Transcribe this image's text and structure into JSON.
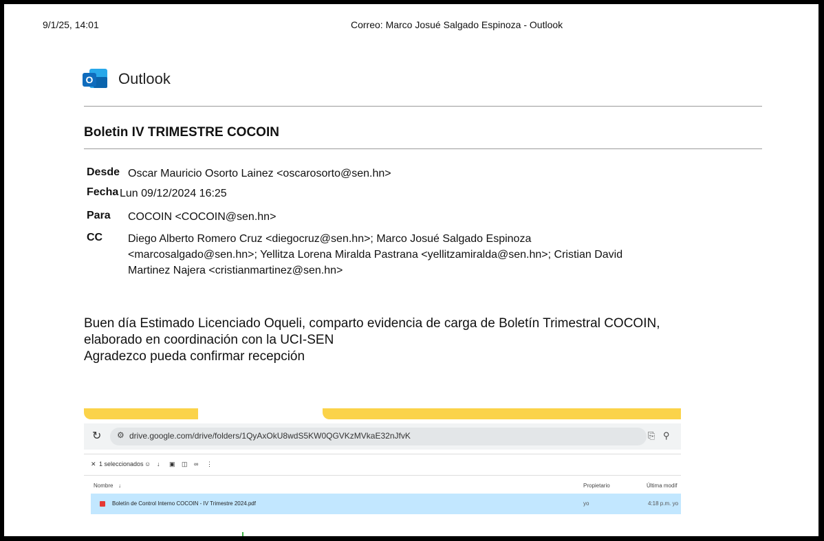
{
  "print_header": {
    "date": "9/1/25, 14:01",
    "title": "Correo: Marco Josué Salgado Espinoza - Outlook"
  },
  "brand": {
    "logo_letter": "O",
    "name": "Outlook"
  },
  "email": {
    "subject": "Boletin IV TRIMESTRE COCOIN",
    "from_label": "Desde",
    "from": "Oscar Mauricio Osorto Lainez <oscarosorto@sen.hn>",
    "date_label": "Fecha",
    "date": "Lun 09/12/2024 16:25",
    "to_label": "Para",
    "to": "COCOIN <COCOIN@sen.hn>",
    "cc_label": "CC",
    "cc_lines": [
      "Diego Alberto Romero Cruz <diegocruz@sen.hn>; Marco Josué Salgado Espinoza",
      "<marcosalgado@sen.hn>; Yellitza Lorena Miralda Pastrana <yellitzamiralda@sen.hn>; Cristian David",
      "Martinez Najera <cristianmartinez@sen.hn>"
    ],
    "body_lines": [
      "Buen día Estimado Licenciado Oqueli, comparto evidencia de carga de Boletín Trimestral COCOIN,",
      "elaborado en coordinación con la UCI-SEN",
      "Agradezco pueda confirmar recepción"
    ]
  },
  "embedded_screenshot": {
    "reload_icon": "reload-icon",
    "url": "drive.google.com/drive/folders/1QyAxOkU8wdS5KW0QGVKzMVkaE32nJfvK",
    "toolbar_selected": "1 seleccionados",
    "col_name": "Nombre",
    "col_owner": "Propietario",
    "col_modified": "Última modif",
    "file_name": "Boletín de Control Interno COCOIN - IV Trimestre 2024.pdf",
    "owner": "yo",
    "modified": "4:18 p.m. yo",
    "highlight_color": "#c2e7ff",
    "accent_color": "#fbd34a"
  }
}
